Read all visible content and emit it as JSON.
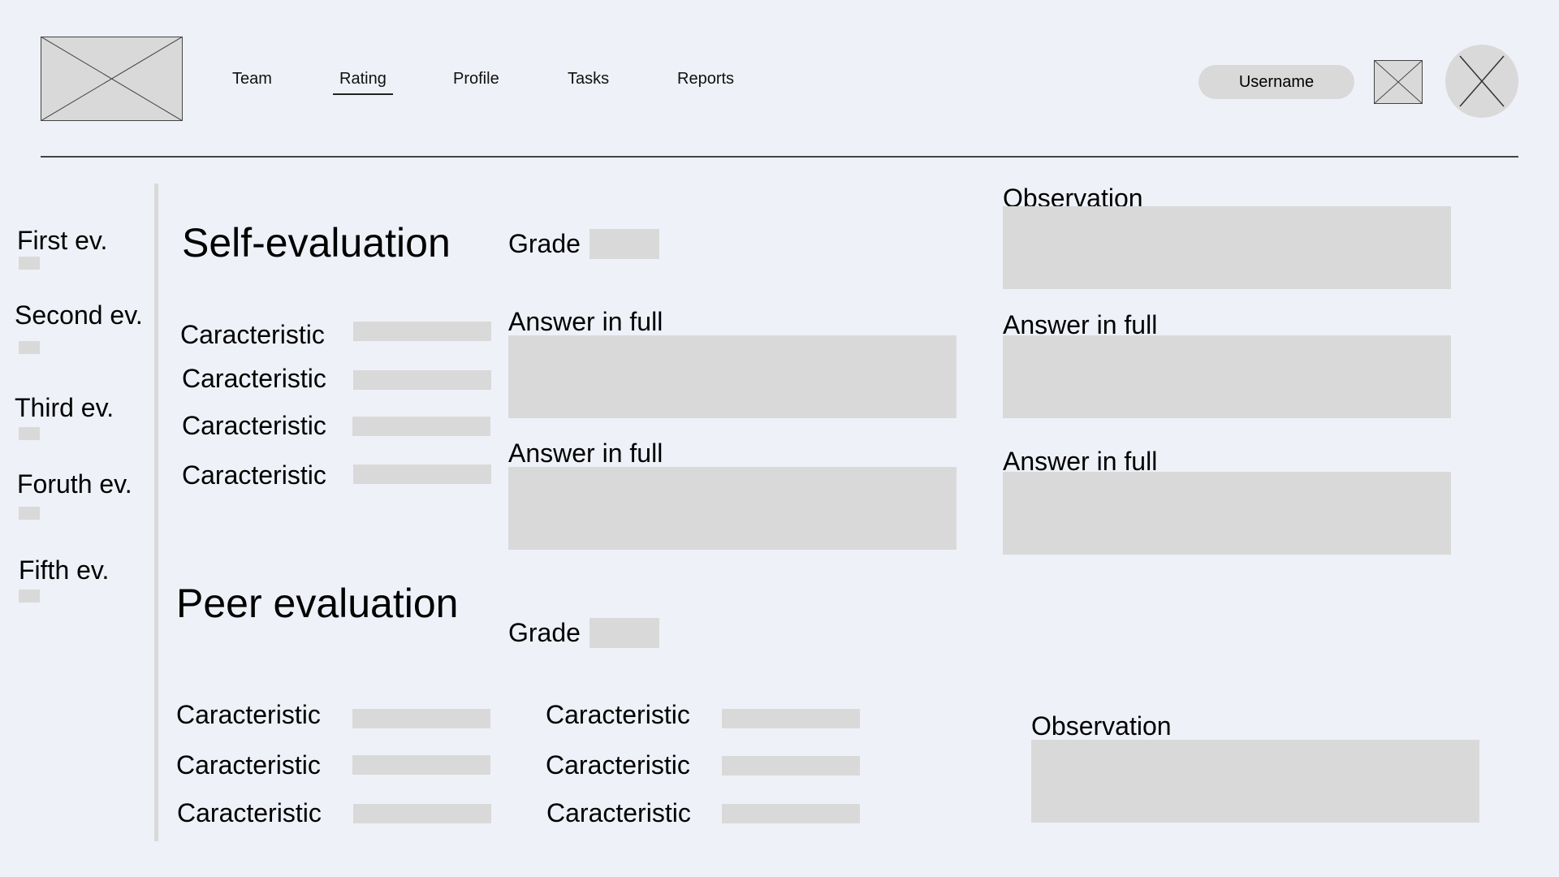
{
  "header": {
    "nav": [
      {
        "label": "Team"
      },
      {
        "label": "Rating",
        "active": true
      },
      {
        "label": "Profile"
      },
      {
        "label": "Tasks"
      },
      {
        "label": "Reports"
      }
    ],
    "username": "Username"
  },
  "sidebar": {
    "items": [
      {
        "label": "First ev."
      },
      {
        "label": "Second ev."
      },
      {
        "label": "Third ev."
      },
      {
        "label": "Foruth ev."
      },
      {
        "label": "Fifth ev."
      }
    ]
  },
  "self_eval": {
    "title": "Self-evaluation",
    "grade_label": "Grade",
    "characteristics": [
      "Caracteristic",
      "Caracteristic",
      "Caracteristic",
      "Caracteristic"
    ],
    "answers_left": [
      "Answer in full",
      "Answer in full"
    ],
    "observation_label": "Observation",
    "answers_right": [
      "Answer in full",
      "Answer in full"
    ]
  },
  "peer_eval": {
    "title": "Peer evaluation",
    "grade_label": "Grade",
    "characteristics_col1": [
      "Caracteristic",
      "Caracteristic",
      "Caracteristic"
    ],
    "characteristics_col2": [
      "Caracteristic",
      "Caracteristic",
      "Caracteristic"
    ],
    "observation_label": "Observation"
  },
  "colors": {
    "background": "#eef1f7",
    "placeholder": "#d9d9d9"
  }
}
